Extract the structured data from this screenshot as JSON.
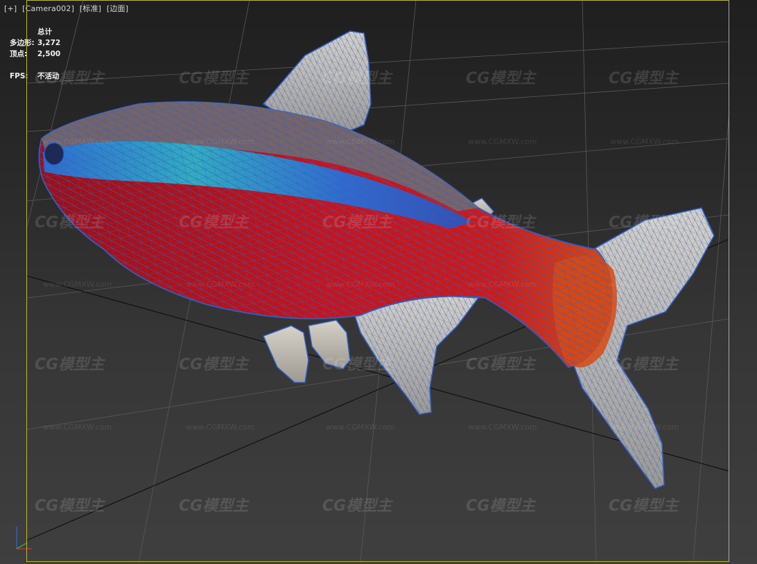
{
  "viewport": {
    "menu_plus": "[+]",
    "camera": "[Camera002]",
    "shading": "[标准]",
    "display_mode": "[边面]"
  },
  "stats": {
    "header": "总计",
    "polygons_label": "多边形:",
    "polygons_value": "3,272",
    "vertices_label": "顶点:",
    "vertices_value": "2,500",
    "fps_label": "FPS:",
    "fps_value": "不活动"
  },
  "watermark": {
    "logo": "CG模型主",
    "url": "www.CGMXW.com"
  },
  "colors": {
    "safe_frame": "#b8b832",
    "wire": "#2e5fc8",
    "body_red": "#c4141c",
    "stripe_blue": "#2a6fd6",
    "stripe_cyan": "#2bb5c7",
    "fin_grey": "#c9c5bb",
    "tail_orange": "#d84a12"
  }
}
